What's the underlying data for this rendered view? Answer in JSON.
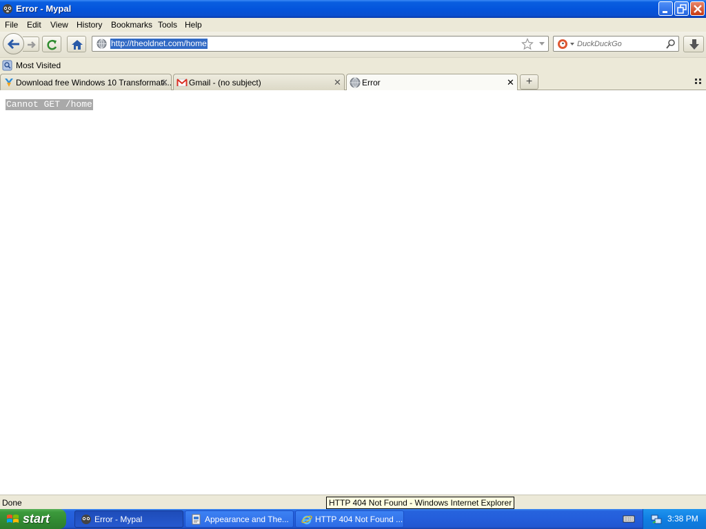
{
  "window": {
    "title": "Error - Mypal"
  },
  "menu": [
    "File",
    "Edit",
    "View",
    "History",
    "Bookmarks",
    "Tools",
    "Help"
  ],
  "nav": {
    "url": "http://theoldnet.com/home",
    "search_placeholder": "DuckDuckGo"
  },
  "bookmarks": {
    "most_visited": "Most Visited"
  },
  "tabs": [
    {
      "label": "Download free Windows 10 Transformati..."
    },
    {
      "label": "Gmail - (no subject)"
    },
    {
      "label": "Error"
    }
  ],
  "content": {
    "error_text": "Cannot GET /home"
  },
  "status": {
    "text": "Done",
    "tooltip": "HTTP 404 Not Found - Windows Internet Explorer"
  },
  "taskbar": {
    "start": "start",
    "items": [
      {
        "label": "Error - Mypal"
      },
      {
        "label": "Appearance and The..."
      },
      {
        "label": "HTTP 404 Not Found ..."
      }
    ],
    "clock": "3:38 PM"
  },
  "colors": {
    "accent": "#0a5fe0",
    "selection": "#316ac5",
    "start_green": "#3c9a3c"
  }
}
